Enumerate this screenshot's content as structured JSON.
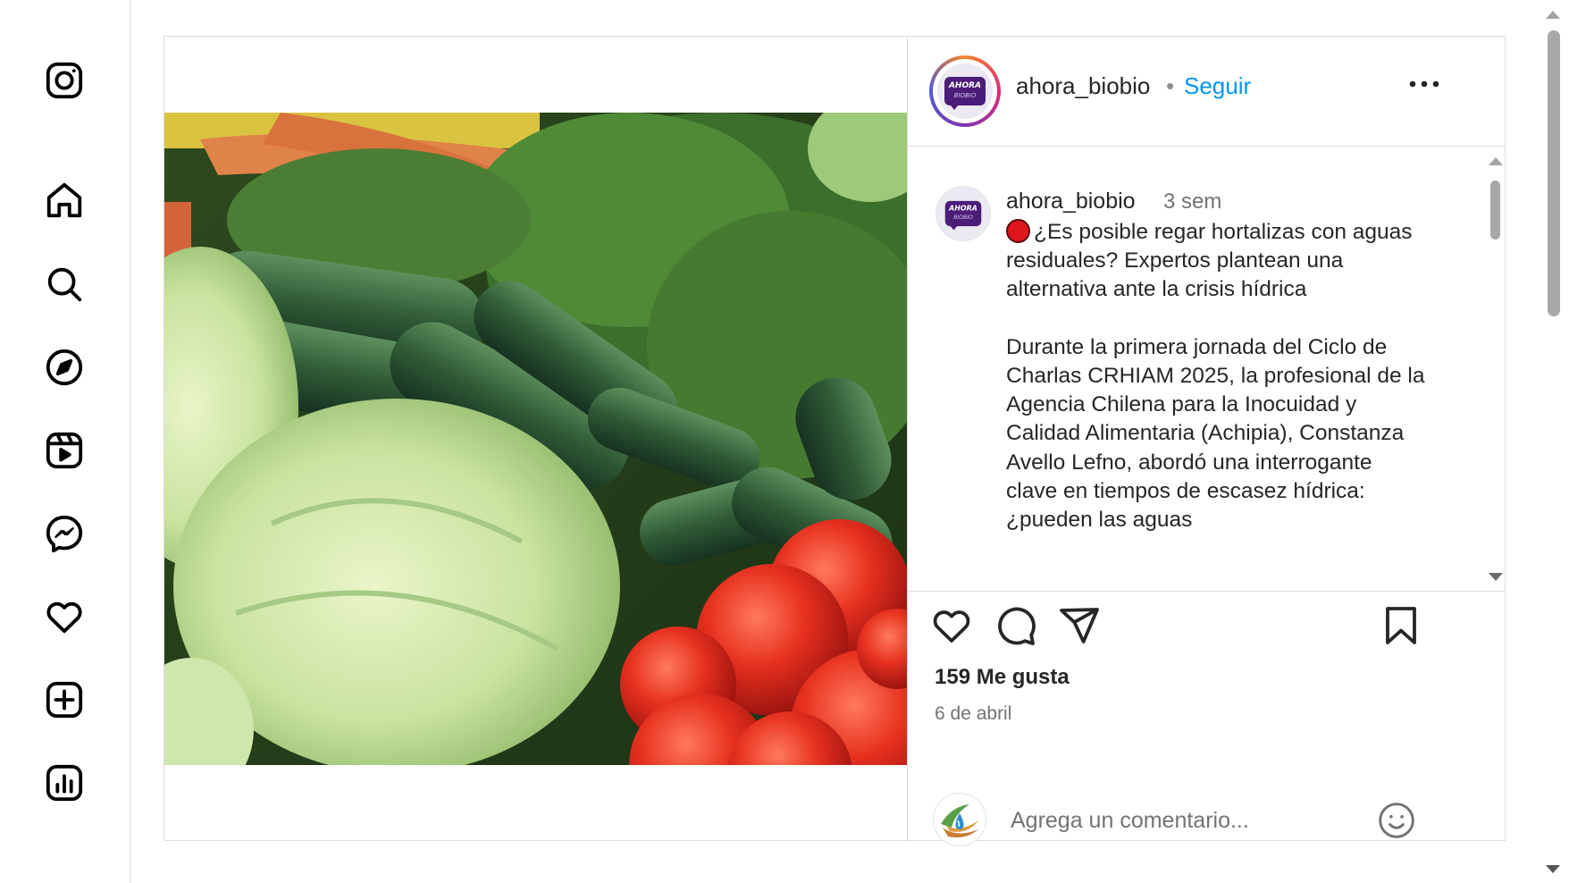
{
  "nav": {
    "items": [
      {
        "icon": "instagram-logo-icon"
      },
      {
        "icon": "home-icon"
      },
      {
        "icon": "search-icon"
      },
      {
        "icon": "explore-icon"
      },
      {
        "icon": "reels-icon"
      },
      {
        "icon": "messenger-icon"
      },
      {
        "icon": "notifications-heart-icon"
      },
      {
        "icon": "create-plus-icon"
      },
      {
        "icon": "dashboard-icon"
      }
    ]
  },
  "post": {
    "author": "ahora_biobio",
    "separator": "•",
    "follow_label": "Seguir",
    "avatar_logo_main": "AHORA",
    "avatar_logo_sub": "BIOBIO",
    "caption": {
      "user": "ahora_biobio",
      "time": "3 sem",
      "text": "¿Es posible regar hortalizas con aguas residuales? Expertos plantean una alternativa ante la crisis hídrica\n\nDurante la primera jornada del Ciclo de Charlas CRHIAM 2025, la profesional de la Agencia Chilena para la Inocuidad y Calidad Alimentaria (Achipia), Constanza Avello Lefno, abordó una interrogante clave en tiempos de escasez hídrica: ¿pueden las aguas"
    },
    "likes": "159 Me gusta",
    "date": "6 de abril",
    "comment_placeholder": "Agrega un comentario..."
  },
  "colors": {
    "accent": "#0095f6",
    "border": "#dbdbdb",
    "muted": "#737373",
    "brand_purple": "#4b1c78"
  }
}
